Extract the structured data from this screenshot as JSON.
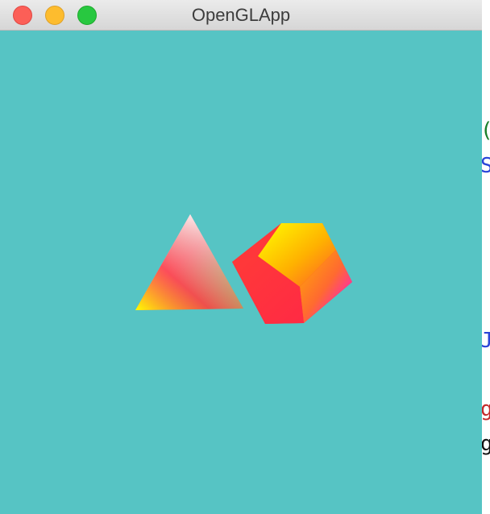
{
  "window": {
    "title": "OpenGLApp",
    "canvas_background": "#56c4c4"
  },
  "titlebar": {
    "close_icon": "close-icon",
    "minimize_icon": "minimize-icon",
    "zoom_icon": "zoom-icon"
  },
  "scene": {
    "objects": [
      {
        "name": "pyramid",
        "shape": "tetrahedron",
        "colors": [
          "#ffffff",
          "#ffff00",
          "#ff2a3a",
          "#00ff22"
        ]
      },
      {
        "name": "cube",
        "shape": "cube",
        "colors": [
          "#ffff00",
          "#ff2a3a",
          "#ff00ff"
        ]
      }
    ]
  },
  "background_editor_fragments": [
    {
      "text": "(",
      "color": "#1a7f2a"
    },
    {
      "text": "S",
      "color": "#2a45d8"
    },
    {
      "text": "J",
      "color": "#2a45d8"
    },
    {
      "text": "g",
      "color": "#c22a2a"
    },
    {
      "text": "g",
      "color": "#111111"
    }
  ]
}
